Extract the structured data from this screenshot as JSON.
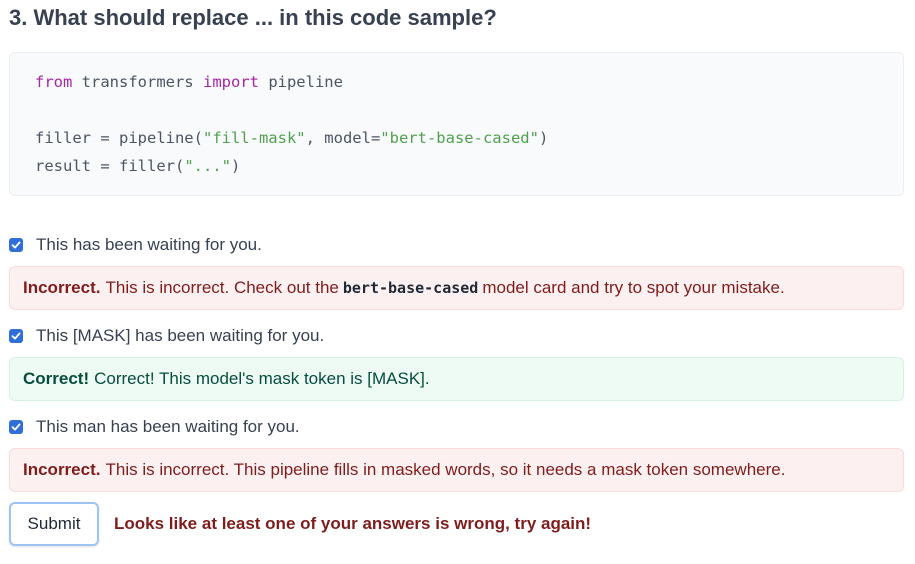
{
  "question": {
    "title": "3. What should replace ... in this code sample?"
  },
  "code": {
    "line1": {
      "kw_from": "from",
      "module": " transformers ",
      "kw_import": "import",
      "rest": " pipeline"
    },
    "line3": {
      "prefix": "filler = pipeline(",
      "arg1": "\"fill-mask\"",
      "mid": ", model=",
      "arg2": "\"bert-base-cased\"",
      "suffix": ")"
    },
    "line4": {
      "prefix": "result = filler(",
      "arg": "\"...\"",
      "suffix": ")"
    }
  },
  "answers": [
    {
      "label": "This has been waiting for you.",
      "checked": true,
      "feedback": {
        "status": "Incorrect.",
        "text_before": "This is incorrect. Check out the",
        "code": "bert-base-cased",
        "text_after": "model card and try to spot your mistake."
      }
    },
    {
      "label": "This [MASK] has been waiting for you.",
      "checked": true,
      "feedback": {
        "status": "Correct!",
        "text": "Correct! This model's mask token is [MASK]."
      }
    },
    {
      "label": "This man has been waiting for you.",
      "checked": true,
      "feedback": {
        "status": "Incorrect.",
        "text": "This is incorrect. This pipeline fills in masked words, so it needs a mask token somewhere."
      }
    }
  ],
  "submit": {
    "label": "Submit"
  },
  "result_message": "Looks like at least one of your answers is wrong, try again!",
  "colors": {
    "checkbox": "#2f6fd6",
    "incorrect_bg": "#fdf0f0",
    "correct_bg": "#eefbf4",
    "incorrect_text": "#7f1d1d",
    "correct_text": "#064e3b",
    "keyword": "#a626a4",
    "string": "#50a14f"
  }
}
